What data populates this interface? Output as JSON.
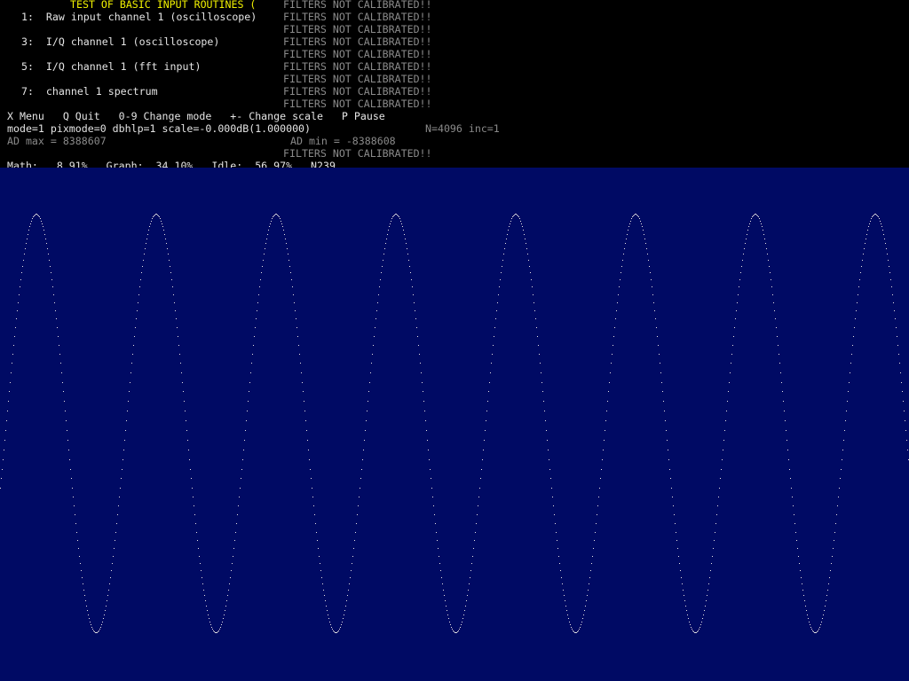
{
  "title": "TEST OF BASIC INPUT ROUTINES (",
  "filters_notice": "FILTERS NOT CALIBRATED!!",
  "modes": [
    "1:  Raw input channel 1 (oscilloscope)",
    "3:  I/Q channel 1 (oscilloscope)",
    "5:  I/Q channel 1 (fft input)",
    "7:  channel 1 spectrum"
  ],
  "commands": "X Menu   Q Quit   0-9 Change mode   +- Change scale   P Pause",
  "status_line": "mode=1 pixmode=0 dbhlp=1 scale=-0.000dB(1.000000)",
  "fft_info": "N=4096 inc=1",
  "ad_max": "AD max = 8388607",
  "ad_min": "AD min = -8388608",
  "perf": "Math:   8.91%   Graph:  34.10%   Idle:  56.97%   N239",
  "colors": {
    "title": "#f0f000",
    "text": "#e4e4e4",
    "dim": "#8a8a8a",
    "terminal_bg": "#000000",
    "scope_bg": "#000a64",
    "trace": "#e4e4e4"
  },
  "chart_data": {
    "type": "line",
    "waveform": "sine",
    "period_samples": 135,
    "phase_deg": -18,
    "peak_value": 8388607,
    "trough_value": -8388608,
    "ylim": [
      -8388608,
      8388607
    ],
    "grid": false,
    "legend": "none"
  }
}
